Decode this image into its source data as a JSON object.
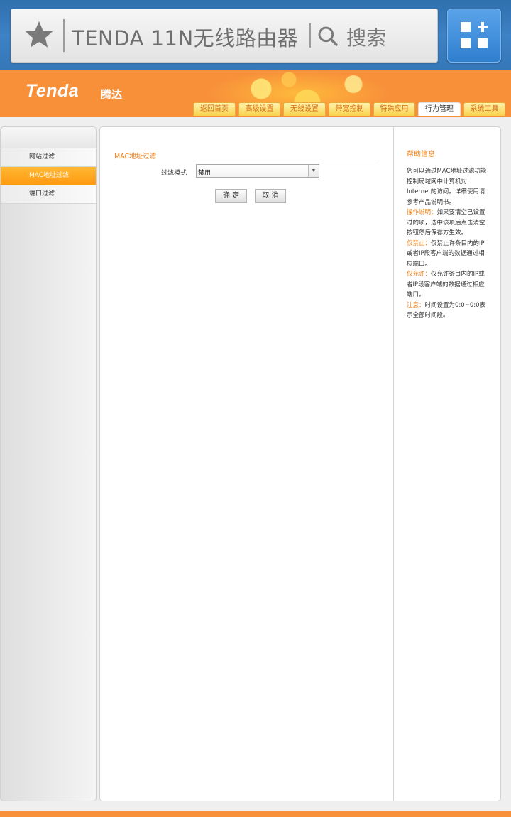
{
  "browser": {
    "url_text": "TENDA 11N无线路由器",
    "search_text": "搜索"
  },
  "header": {
    "logo": "Tenda",
    "logo_cn": "腾达"
  },
  "tabs": [
    {
      "label": "返回首页"
    },
    {
      "label": "高级设置"
    },
    {
      "label": "无线设置"
    },
    {
      "label": "带宽控制"
    },
    {
      "label": "特殊应用"
    },
    {
      "label": "行为管理"
    },
    {
      "label": "系统工具"
    }
  ],
  "active_tab": "行为管理",
  "sidebar": {
    "items": [
      {
        "label": "网站过滤"
      },
      {
        "label": "MAC地址过滤"
      },
      {
        "label": "端口过滤"
      }
    ]
  },
  "main": {
    "section_title": "MAC地址过滤",
    "filter_mode_label": "过滤模式",
    "filter_mode_value": "禁用",
    "ok_label": "确 定",
    "cancel_label": "取 消"
  },
  "help": {
    "title": "帮助信息",
    "intro": "您可以通过MAC地址过滤功能控制局域网中计算机对Internet的访问。详细使用请参考产品说明书。",
    "op_kw": "操作说明：",
    "op_text": "如果要清空已设置过的项，选中该项后点击清空按钮然后保存方生效。",
    "deny_kw": "仅禁止：",
    "deny_text": "仅禁止许条目内的IP或者IP段客户端的数据通过相应端口。",
    "allow_kw": "仅允许：",
    "allow_text": "仅允许条目内的IP或者IP段客户端的数据通过相应端口。",
    "note_kw": "注意：",
    "note_text": "时间设置为0:0~0:0表示全部时间段。"
  },
  "colors": {
    "accent": "#f07e12",
    "header_orange": "#f8903a",
    "browser_blue": "#3577b8"
  }
}
